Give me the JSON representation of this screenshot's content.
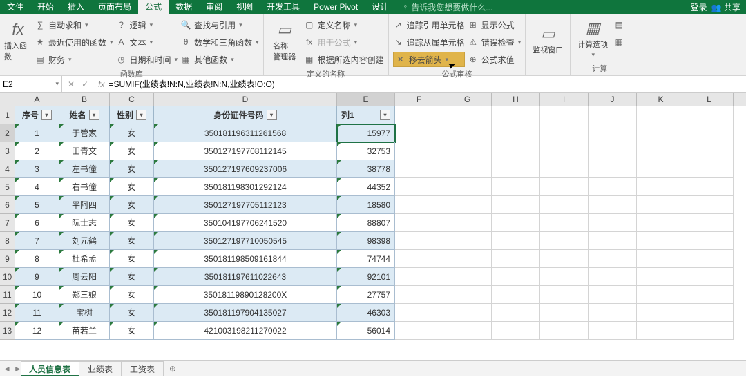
{
  "menu": {
    "tabs": [
      "文件",
      "开始",
      "插入",
      "页面布局",
      "公式",
      "数据",
      "审阅",
      "视图",
      "开发工具",
      "Power Pivot",
      "设计"
    ],
    "active": "公式",
    "tellme": "告诉我您想要做什么...",
    "login": "登录",
    "share": "共享"
  },
  "ribbon": {
    "g1": {
      "insert_fn": "插入函数",
      "fx": "fx",
      "autosum": "自动求和",
      "recent": "最近使用的函数",
      "financial": "财务",
      "logical": "逻辑",
      "text": "文本",
      "datetime": "日期和时间",
      "lookup": "查找与引用",
      "mathtrig": "数学和三角函数",
      "other": "其他函数",
      "label": "函数库"
    },
    "g2": {
      "name_mgr": "名称\n管理器",
      "define": "定义名称",
      "usein": "用于公式",
      "create": "根据所选内容创建",
      "label": "定义的名称"
    },
    "g3": {
      "trace_p": "追踪引用单元格",
      "trace_d": "追踪从属单元格",
      "remove": "移去箭头",
      "showf": "显示公式",
      "errchk": "错误检查",
      "eval": "公式求值",
      "label": "公式审核"
    },
    "g4": {
      "watch": "监视窗口"
    },
    "g5": {
      "calc": "计算选项",
      "label": "计算"
    }
  },
  "namebox": "E2",
  "formula": "=SUMIF(业绩表!N:N,业绩表!N:N,业绩表!O:O)",
  "cols": [
    "A",
    "B",
    "C",
    "D",
    "E",
    "F",
    "G",
    "H",
    "I",
    "J",
    "K",
    "L"
  ],
  "headers": {
    "A": "序号",
    "B": "姓名",
    "C": "性别",
    "D": "身份证件号码",
    "E": "列1"
  },
  "rows": [
    {
      "n": 1,
      "a": "1",
      "b": "于管家",
      "c": "女",
      "d": "350181196311261568",
      "e": "15977"
    },
    {
      "n": 2,
      "a": "2",
      "b": "田青文",
      "c": "女",
      "d": "350127197708112145",
      "e": "32753"
    },
    {
      "n": 3,
      "a": "3",
      "b": "左书僮",
      "c": "女",
      "d": "350127197609237006",
      "e": "38778"
    },
    {
      "n": 4,
      "a": "4",
      "b": "右书僮",
      "c": "女",
      "d": "350181198301292124",
      "e": "44352"
    },
    {
      "n": 5,
      "a": "5",
      "b": "平阿四",
      "c": "女",
      "d": "350127197705112123",
      "e": "18580"
    },
    {
      "n": 6,
      "a": "6",
      "b": "阮士志",
      "c": "女",
      "d": "350104197706241520",
      "e": "88807"
    },
    {
      "n": 7,
      "a": "7",
      "b": "刘元鹤",
      "c": "女",
      "d": "350127197710050545",
      "e": "98398"
    },
    {
      "n": 8,
      "a": "8",
      "b": "杜希孟",
      "c": "女",
      "d": "350181198509161844",
      "e": "74744"
    },
    {
      "n": 9,
      "a": "9",
      "b": "周云阳",
      "c": "女",
      "d": "350181197611022643",
      "e": "92101"
    },
    {
      "n": 10,
      "a": "10",
      "b": "郑三娘",
      "c": "女",
      "d": "35018119890128200X",
      "e": "27757"
    },
    {
      "n": 11,
      "a": "11",
      "b": "宝树",
      "c": "女",
      "d": "350181197904135027",
      "e": "46303"
    },
    {
      "n": 12,
      "a": "12",
      "b": "苗若兰",
      "c": "女",
      "d": "421003198211270022",
      "e": "56014"
    }
  ],
  "sheets": {
    "tabs": [
      "人员信息表",
      "业绩表",
      "工资表"
    ],
    "active": "人员信息表"
  }
}
